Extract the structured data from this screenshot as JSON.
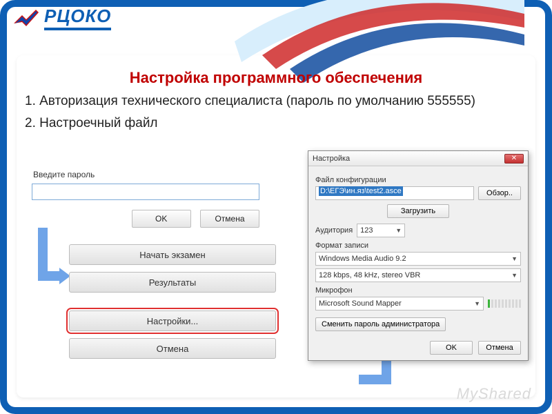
{
  "logo_text": "РЦОКО",
  "title": "Настройка программного обеспечения",
  "step1": "1. Авторизация технического специалиста (пароль по умолчанию 555555)",
  "step2": "2. Настроечный файл",
  "auth": {
    "label": "Введите пароль",
    "ok": "OK",
    "cancel": "Отмена"
  },
  "menu": {
    "start_exam": "Начать экзамен",
    "results": "Результаты",
    "settings": "Настройки...",
    "cancel": "Отмена"
  },
  "settings": {
    "window_title": "Настройка",
    "config_label": "Файл конфигурации",
    "config_path": "D:\\ЕГЭ\\ин.яз\\test2.asce",
    "browse": "Обзор..",
    "load": "Загрузить",
    "auditory_label": "Аудитория",
    "auditory_value": "123",
    "format_label": "Формат записи",
    "codec": "Windows Media Audio 9.2",
    "bitrate": "128 kbps, 48 kHz, stereo VBR",
    "mic_label": "Микрофон",
    "mic_value": "Microsoft Sound Mapper",
    "change_pwd": "Сменить пароль администратора",
    "ok": "OK",
    "cancel": "Отмена"
  },
  "watermark": "MyShared"
}
